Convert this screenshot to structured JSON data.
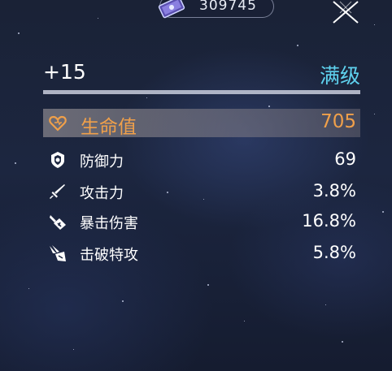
{
  "currency": {
    "icon": "ticket-pass-icon",
    "value": "309745"
  },
  "close": {
    "icon": "close-icon"
  },
  "header": {
    "level": "+15",
    "max_label": "满级"
  },
  "colors": {
    "accent_orange": "#f0a04a",
    "max_cyan": "#5fd2ef"
  },
  "stats": {
    "main": {
      "icon": "heart-icon",
      "label": "生命值",
      "value": "705"
    },
    "items": [
      {
        "icon": "shield-icon",
        "label": "防御力",
        "value": "69"
      },
      {
        "icon": "sword-icon",
        "label": "攻击力",
        "value": "3.8%"
      },
      {
        "icon": "crit-damage-icon",
        "label": "暴击伤害",
        "value": "16.8%"
      },
      {
        "icon": "break-effect-icon",
        "label": "击破特攻",
        "value": "5.8%"
      }
    ]
  }
}
